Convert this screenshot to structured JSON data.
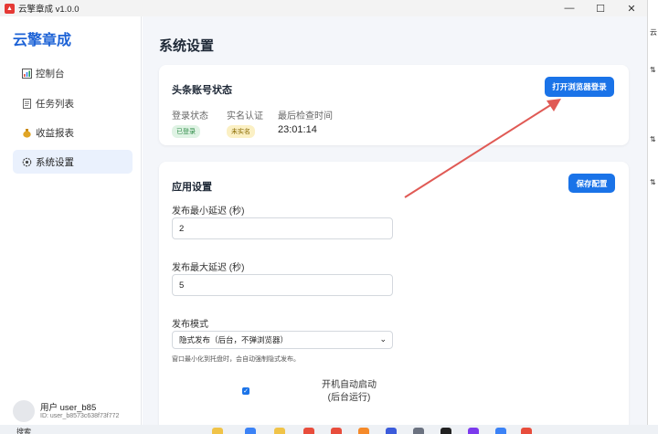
{
  "window": {
    "title": "云擎章成 v1.0.0",
    "minimize_icon": "minimize-icon",
    "maximize_icon": "maximize-icon",
    "close_icon": "close-icon"
  },
  "sidebar": {
    "brand": "云擎章成",
    "items": [
      {
        "label": "控制台",
        "icon": "dashboard-icon",
        "active": false
      },
      {
        "label": "任务列表",
        "icon": "task-list-icon",
        "active": false
      },
      {
        "label": "收益报表",
        "icon": "money-bag-icon",
        "active": false
      },
      {
        "label": "系统设置",
        "icon": "gear-icon",
        "active": true
      }
    ],
    "user": {
      "name": "用户 user_b85",
      "id": "ID: user_b8573c638f73f772"
    }
  },
  "main": {
    "page_title": "系统设置",
    "account_card": {
      "title": "头条账号状态",
      "open_browser_button": "打开浏览器登录",
      "login_status_label": "登录状态",
      "login_status_value": "已登录",
      "realname_label": "实名认证",
      "realname_value": "未实名",
      "last_check_label": "最后检查时间",
      "last_check_value": "23:01:14"
    },
    "app_settings": {
      "title": "应用设置",
      "save_button": "保存配置",
      "min_delay_label": "发布最小延迟 (秒)",
      "min_delay_value": "2",
      "max_delay_label": "发布最大延迟 (秒)",
      "max_delay_value": "5",
      "mode_label": "发布模式",
      "mode_value": "隐式发布（后台，不弹浏览器）",
      "mode_hint": "窗口最小化到托盘时，会自动强制隐式发布。",
      "autostart_checked": true,
      "autostart_label_line1": "开机自动启动",
      "autostart_label_line2": "(后台运行)"
    }
  },
  "taskbar": {
    "search_text": "搜索"
  },
  "colors": {
    "accent": "#1a73e8",
    "brand": "#1e63d6",
    "annotation_arrow": "#e05a55"
  }
}
